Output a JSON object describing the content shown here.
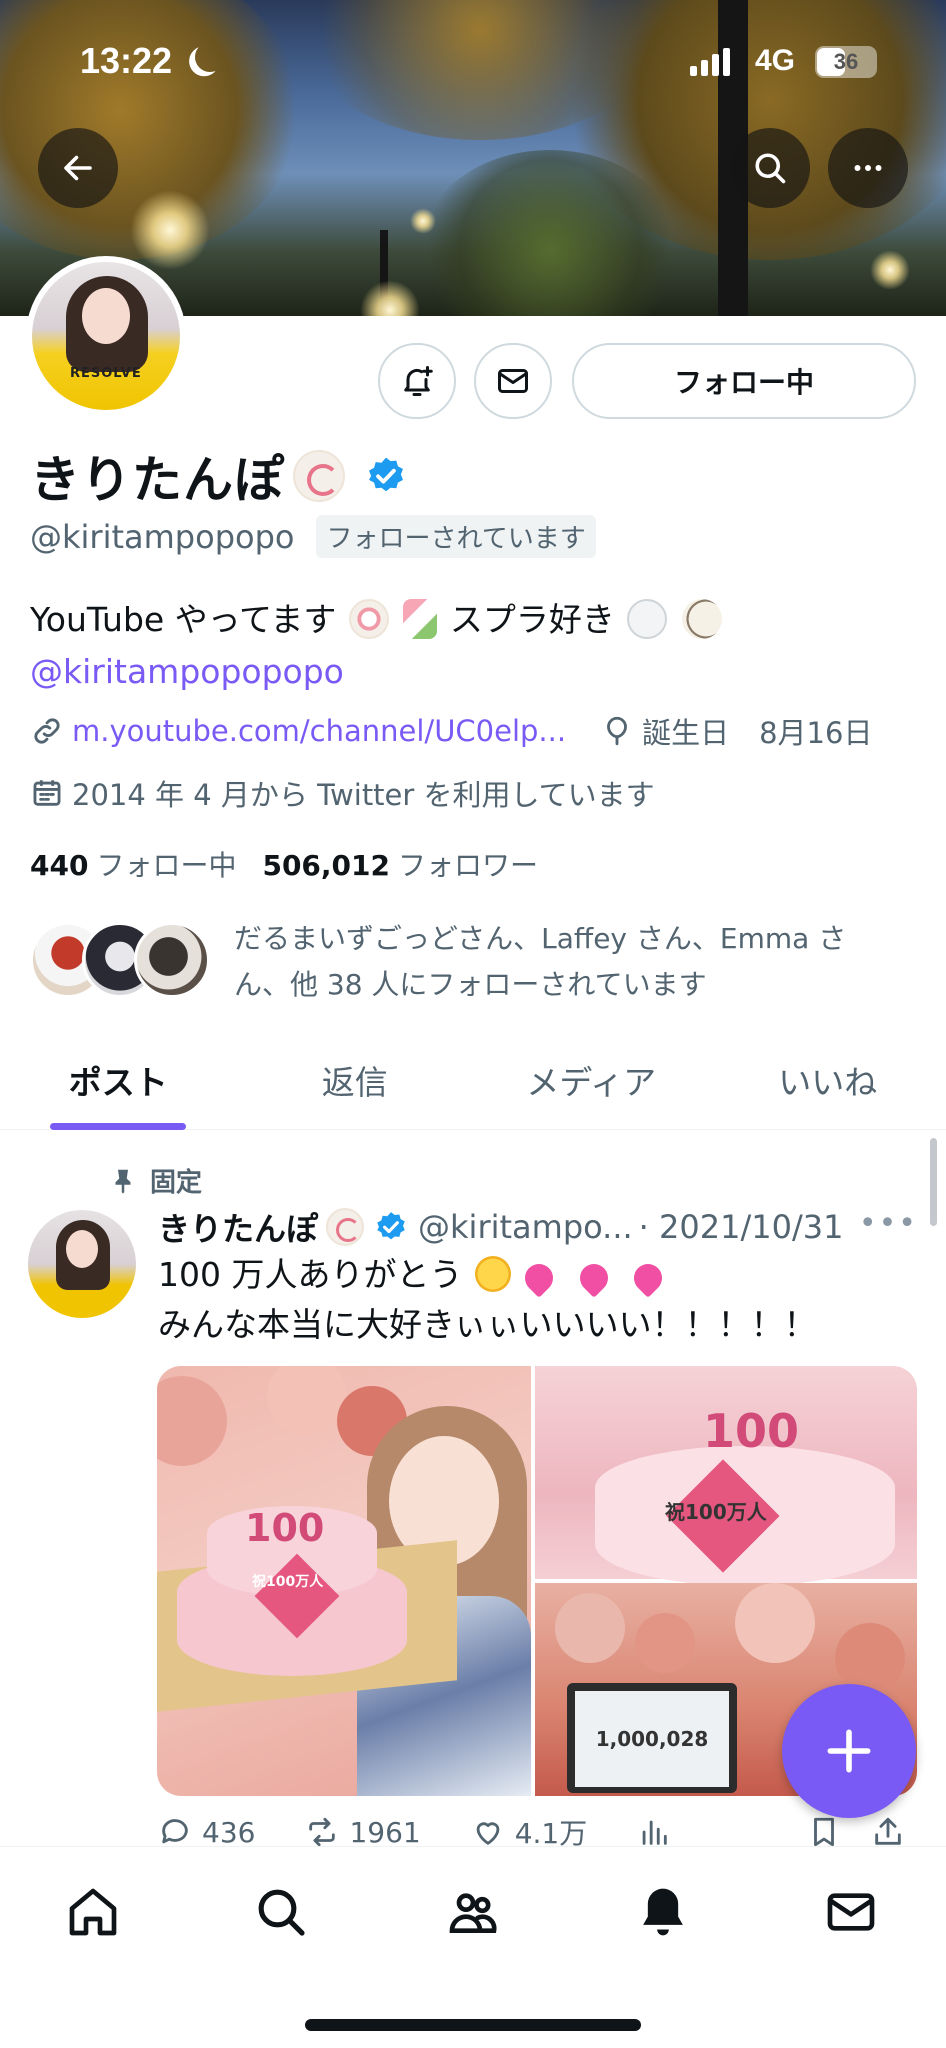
{
  "status_bar": {
    "time": "13:22",
    "network": "4G",
    "battery": "36"
  },
  "profile": {
    "display_name": "きりたんぽ",
    "handle": "@kiritampopopo",
    "follows_you": "フォローされています",
    "follow_button": "フォロー中",
    "bio_line1": "YouTube やってます",
    "bio_line1_b": "スプラ好き",
    "bio_mention": "@kiritampopopopo",
    "link": "m.youtube.com/channel/UC0elp...",
    "birthday_label": "誕生日",
    "birthday": "8月16日",
    "joined": "2014 年 4 月から Twitter を利用しています",
    "following_count": "440",
    "following_label": "フォロー中",
    "followers_count": "506,012",
    "followers_label": "フォロワー",
    "mutuals_text": "だるまいずごっどさん、Laffey さん、Emma さん、他 38 人にフォローされています"
  },
  "tabs": [
    {
      "label": "ポスト"
    },
    {
      "label": "返信"
    },
    {
      "label": "メディア"
    },
    {
      "label": "いいね"
    }
  ],
  "post": {
    "pinned_label": "固定",
    "author": "きりたんぽ",
    "handle": "@kiritampo...",
    "date": "· 2021/10/31",
    "text_line1": "100 万人ありがとう",
    "text_line2": "みんな本当に大好きぃぃいいいい！！！！！",
    "media_cake_number": "100",
    "media_cake_text": "祝100万人",
    "media_counter": "1,000,028",
    "replies": "436",
    "retweets": "1961",
    "likes": "4.1万"
  },
  "colors": {
    "accent": "#7a5af5",
    "verified": "#1d9bf0",
    "text_secondary": "#536471"
  },
  "icons": {
    "back": "arrow-left-icon",
    "search": "search-icon",
    "more": "more-icon",
    "notify": "bell-plus-icon",
    "message": "envelope-icon",
    "link": "link-icon",
    "birthday": "balloon-icon",
    "calendar": "calendar-icon",
    "pin": "pin-icon",
    "compose": "plus-icon",
    "nav": [
      "home-icon",
      "search-icon",
      "communities-icon",
      "bell-icon",
      "envelope-icon"
    ]
  }
}
